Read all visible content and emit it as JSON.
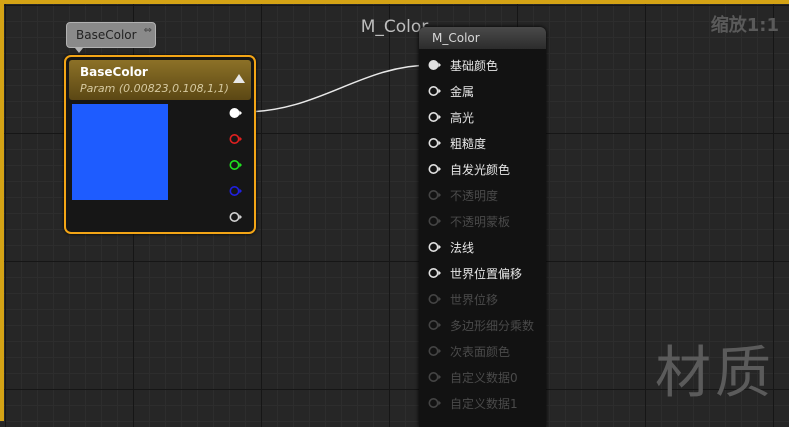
{
  "graph": {
    "title": "M_Color",
    "zoom": "缩放1:1",
    "watermark": "材质"
  },
  "comment": {
    "text": "BaseColor"
  },
  "param_node": {
    "title": "BaseColor",
    "subtitle": "Param (0.00823,0.108,1,1)",
    "preview_color": "#1e5cff",
    "pins": [
      {
        "name": "rgba",
        "color": "#ffffff",
        "filled": true
      },
      {
        "name": "r",
        "color": "#e02020",
        "filled": false
      },
      {
        "name": "g",
        "color": "#20e020",
        "filled": false
      },
      {
        "name": "b",
        "color": "#2020e0",
        "filled": false
      },
      {
        "name": "a",
        "color": "#d0d0d0",
        "filled": false
      }
    ]
  },
  "material_node": {
    "title": "M_Color",
    "inputs": [
      {
        "label": "基础颜色",
        "enabled": true,
        "connected": true
      },
      {
        "label": "金属",
        "enabled": true,
        "connected": false
      },
      {
        "label": "高光",
        "enabled": true,
        "connected": false
      },
      {
        "label": "粗糙度",
        "enabled": true,
        "connected": false
      },
      {
        "label": "自发光颜色",
        "enabled": true,
        "connected": false
      },
      {
        "label": "不透明度",
        "enabled": false,
        "connected": false
      },
      {
        "label": "不透明蒙板",
        "enabled": false,
        "connected": false
      },
      {
        "label": "法线",
        "enabled": true,
        "connected": false
      },
      {
        "label": "世界位置偏移",
        "enabled": true,
        "connected": false
      },
      {
        "label": "世界位移",
        "enabled": false,
        "connected": false
      },
      {
        "label": "多边形细分乘数",
        "enabled": false,
        "connected": false
      },
      {
        "label": "次表面颜色",
        "enabled": false,
        "connected": false
      },
      {
        "label": "自定义数据0",
        "enabled": false,
        "connected": false
      },
      {
        "label": "自定义数据1",
        "enabled": false,
        "connected": false
      }
    ]
  }
}
